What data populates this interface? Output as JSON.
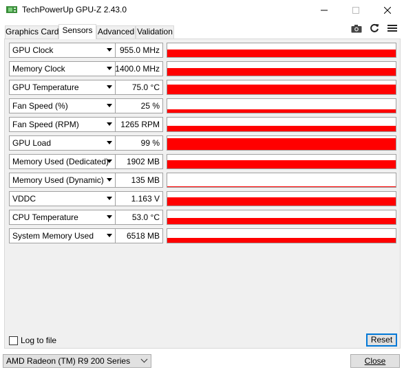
{
  "window": {
    "title": "TechPowerUp GPU-Z 2.43.0",
    "minimize_icon": "minimize-icon",
    "maximize_icon": "maximize-icon",
    "close_icon": "close-icon"
  },
  "tabs": [
    {
      "label": "Graphics Card",
      "active": false
    },
    {
      "label": "Sensors",
      "active": true
    },
    {
      "label": "Advanced",
      "active": false
    },
    {
      "label": "Validation",
      "active": false
    }
  ],
  "toolbar": {
    "icons": [
      "camera-icon",
      "refresh-icon",
      "menu-icon"
    ]
  },
  "colors": {
    "graph": "#ff0000",
    "accent": "#0078d7"
  },
  "sensors": [
    {
      "name": "GPU Clock",
      "value": "955.0 MHz",
      "level": 0.55
    },
    {
      "name": "Memory Clock",
      "value": "1400.0 MHz",
      "level": 0.55
    },
    {
      "name": "GPU Temperature",
      "value": "75.0 °C",
      "level": 0.7
    },
    {
      "name": "Fan Speed (%)",
      "value": "25 %",
      "level": 0.25
    },
    {
      "name": "Fan Speed (RPM)",
      "value": "1265 RPM",
      "level": 0.4
    },
    {
      "name": "GPU Load",
      "value": "99 %",
      "level": 0.85
    },
    {
      "name": "Memory Used (Dedicated)",
      "value": "1902 MB",
      "level": 0.6
    },
    {
      "name": "Memory Used (Dynamic)",
      "value": "135 MB",
      "level": 0.05
    },
    {
      "name": "VDDC",
      "value": "1.163 V",
      "level": 0.6
    },
    {
      "name": "CPU Temperature",
      "value": "53.0 °C",
      "level": 0.45
    },
    {
      "name": "System Memory Used",
      "value": "6518 MB",
      "level": 0.35
    }
  ],
  "footer": {
    "log_to_file_label": "Log to file",
    "log_to_file_checked": false,
    "reset_label": "Reset",
    "gpu_selected": "AMD Radeon (TM) R9 200 Series",
    "close_label": "Close"
  }
}
